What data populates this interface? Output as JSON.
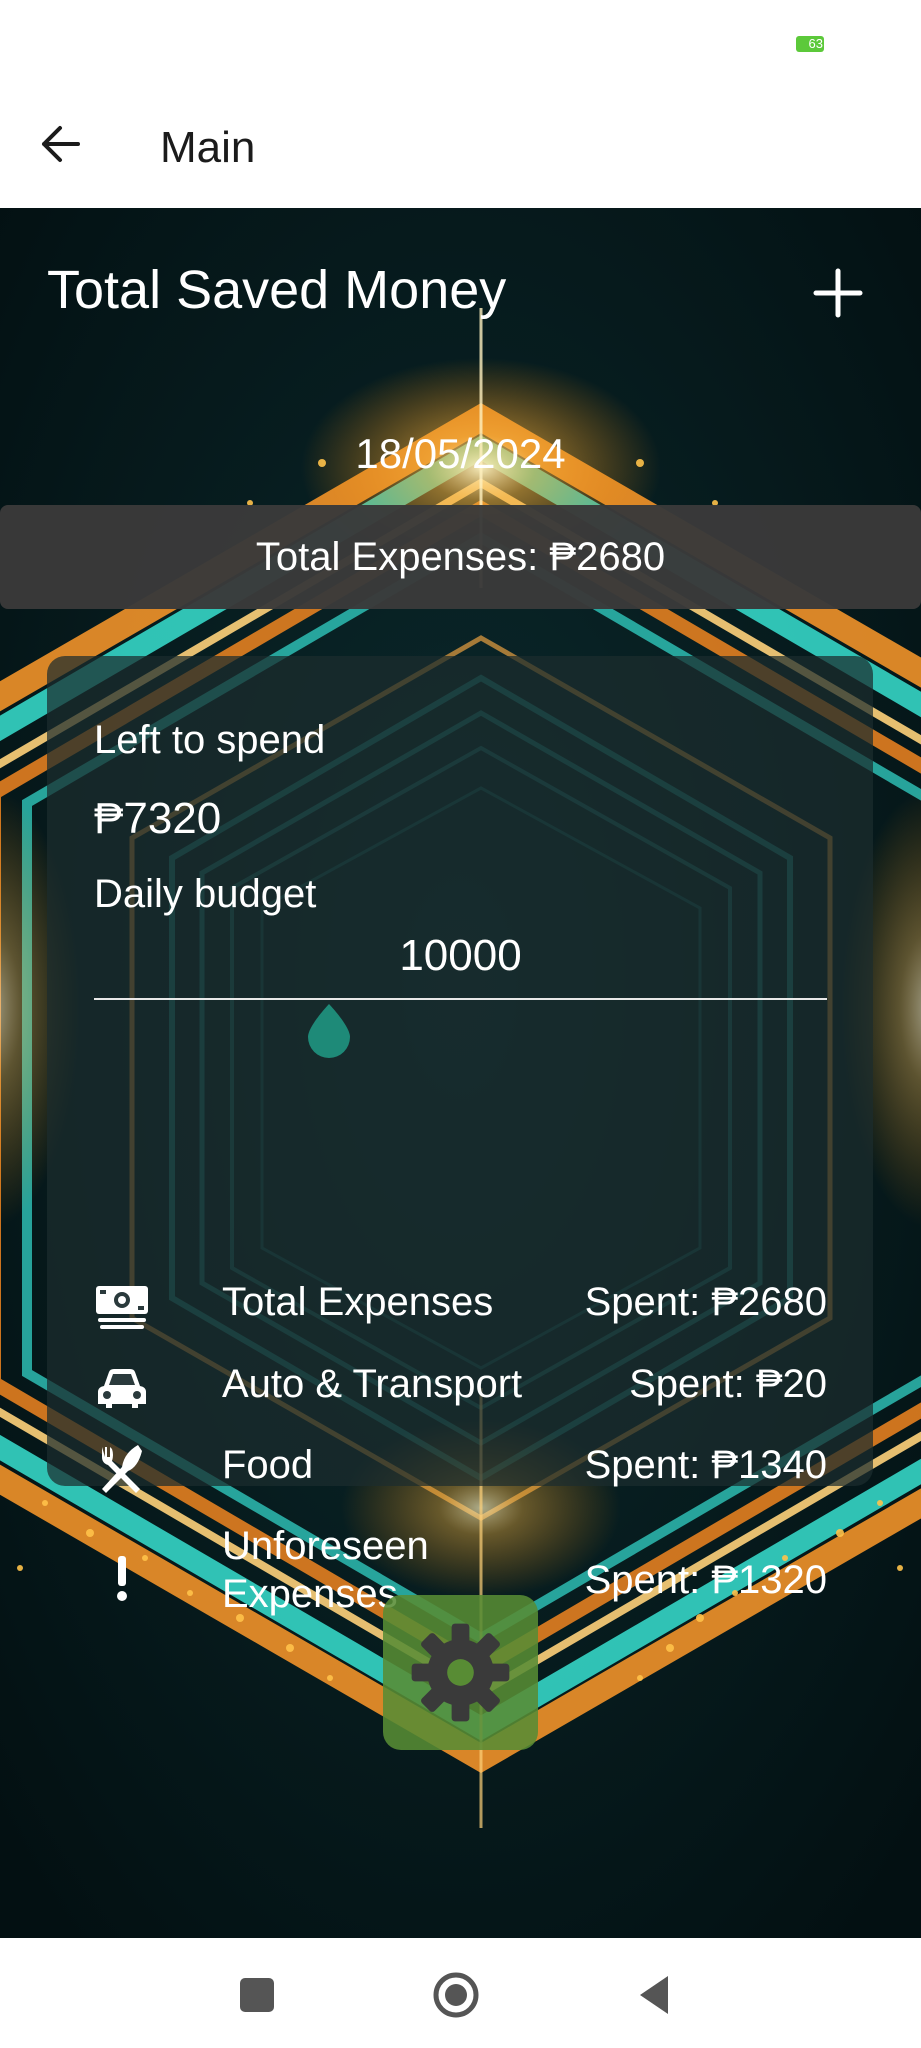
{
  "status_bar": {
    "battery": "63",
    "battery_color": "#5cc93a"
  },
  "app_bar": {
    "title": "Main",
    "back_icon": "arrow-left-icon"
  },
  "saved": {
    "title": "Total Saved Money",
    "add_icon": "plus-icon"
  },
  "date": "18/05/2024",
  "expenses_banner": "Total Expenses: ₱2680",
  "card": {
    "left_to_spend_label": "Left to spend",
    "left_to_spend_value": "₱7320",
    "daily_budget_label": "Daily budget",
    "daily_budget_value": "10000",
    "slider_position": 0.32,
    "categories": [
      {
        "icon": "money-stack-icon",
        "name": "Total Expenses",
        "spent": "Spent: ₱2680"
      },
      {
        "icon": "car-icon",
        "name": "Auto & Transport",
        "spent": "Spent: ₱20"
      },
      {
        "icon": "fork-knife-icon",
        "name": "Food",
        "spent": "Spent: ₱1340"
      },
      {
        "icon": "exclamation-icon",
        "name": "Unforeseen Expenses",
        "spent": "Spent: ₱1320"
      }
    ]
  },
  "settings": {
    "icon": "gear-icon",
    "button_color": "#588c34"
  },
  "colors": {
    "accent_teal": "#1e8a78",
    "banner_bg": "#3a3a3a"
  },
  "nav_bar": {
    "items": [
      "recents-square-icon",
      "home-circle-icon",
      "back-triangle-icon"
    ]
  }
}
